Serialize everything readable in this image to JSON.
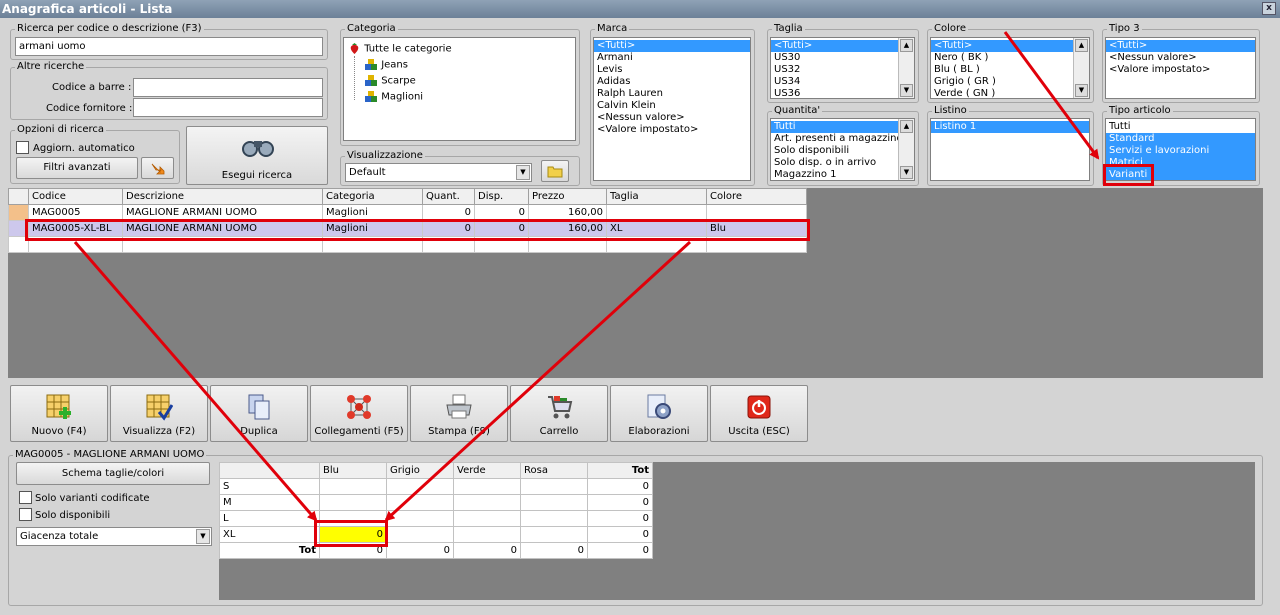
{
  "window": {
    "title": "Anagrafica articoli  - Lista",
    "close": "x"
  },
  "search": {
    "label": "Ricerca per codice o descrizione (F3)",
    "value": "armani uomo",
    "other_label": "Altre ricerche",
    "barcode_label": "Codice a barre :",
    "supplier_label": "Codice fornitore :",
    "options_label": "Opzioni di ricerca",
    "auto_update": "Aggiorn. automatico",
    "advanced_filters": "Filtri avanzati",
    "run_search": "Esegui ricerca"
  },
  "categoria": {
    "label": "Categoria",
    "root": "Tutte le categorie",
    "children": [
      "Jeans",
      "Scarpe",
      "Maglioni"
    ]
  },
  "visualizzazione": {
    "label": "Visualizzazione",
    "value": "Default"
  },
  "marca": {
    "label": "Marca",
    "items": [
      "<Tutti>",
      "Armani",
      "Levis",
      "Adidas",
      "Ralph Lauren",
      "Calvin Klein",
      "<Nessun valore>",
      "<Valore impostato>"
    ]
  },
  "taglia": {
    "label": "Taglia",
    "items": [
      "<Tutti>",
      "US30",
      "US32",
      "US34",
      "US36"
    ]
  },
  "colore": {
    "label": "Colore",
    "items": [
      "<Tutti>",
      "Nero ( BK )",
      "Blu ( BL )",
      "Grigio ( GR )",
      "Verde ( GN )"
    ]
  },
  "tipo3": {
    "label": "Tipo 3",
    "items": [
      "<Tutti>",
      "<Nessun valore>",
      "<Valore impostato>"
    ]
  },
  "quantita": {
    "label": "Quantita'",
    "items": [
      "Tutti",
      "Art. presenti a magazzino",
      "Solo disponibili",
      "Solo disp. o in arrivo",
      "Magazzino 1"
    ]
  },
  "listino": {
    "label": "Listino",
    "items": [
      "Listino 1"
    ]
  },
  "tipo_articolo": {
    "label": "Tipo articolo",
    "items": [
      "Tutti",
      "Standard",
      "Servizi e lavorazioni",
      "Matrici",
      "Varianti"
    ]
  },
  "table": {
    "columns": [
      "Codice",
      "Descrizione",
      "Categoria",
      "Quant.",
      "Disp.",
      "Prezzo",
      "Taglia",
      "Colore"
    ],
    "rows": [
      [
        "MAG0005",
        "MAGLIONE ARMANI UOMO",
        "Maglioni",
        "0",
        "0",
        "160,00",
        "",
        ""
      ],
      [
        "MAG0005-XL-BL",
        "MAGLIONE ARMANI UOMO",
        "Maglioni",
        "0",
        "0",
        "160,00",
        "XL",
        "Blu"
      ]
    ]
  },
  "toolbar": [
    {
      "label": "Nuovo (F4)",
      "icon": "new-grid-icon"
    },
    {
      "label": "Visualizza (F2)",
      "icon": "view-grid-icon"
    },
    {
      "label": "Duplica",
      "icon": "duplicate-icon"
    },
    {
      "label": "Collegamenti (F5)",
      "icon": "links-icon"
    },
    {
      "label": "Stampa (F9)",
      "icon": "printer-icon"
    },
    {
      "label": "Carrello",
      "icon": "cart-icon"
    },
    {
      "label": "Elaborazioni",
      "icon": "gear-icon"
    },
    {
      "label": "Uscita (ESC)",
      "icon": "power-icon"
    }
  ],
  "detail": {
    "title": "MAG0005 - MAGLIONE ARMANI UOMO",
    "schema_button": "Schema taglie/colori",
    "only_coded": "Solo varianti codificate",
    "only_available": "Solo disponibili",
    "giacenza": "Giacenza totale",
    "colors": [
      "Blu",
      "Grigio",
      "Verde",
      "Rosa"
    ],
    "tot_label": "Tot",
    "sizes": [
      {
        "size": "S",
        "vals": [
          "",
          "",
          "",
          ""
        ],
        "tot": "0"
      },
      {
        "size": "M",
        "vals": [
          "",
          "",
          "",
          ""
        ],
        "tot": "0"
      },
      {
        "size": "L",
        "vals": [
          "",
          "",
          "",
          ""
        ],
        "tot": "0"
      },
      {
        "size": "XL",
        "vals": [
          "0",
          "",
          "",
          ""
        ],
        "tot": "0"
      }
    ],
    "totals": [
      "0",
      "0",
      "0",
      "0",
      "0"
    ]
  },
  "colors": {
    "accent": "#3399ff",
    "highlight": "#ffff00",
    "annotation": "#e0000a",
    "title_bar": "#7a8ca2"
  }
}
